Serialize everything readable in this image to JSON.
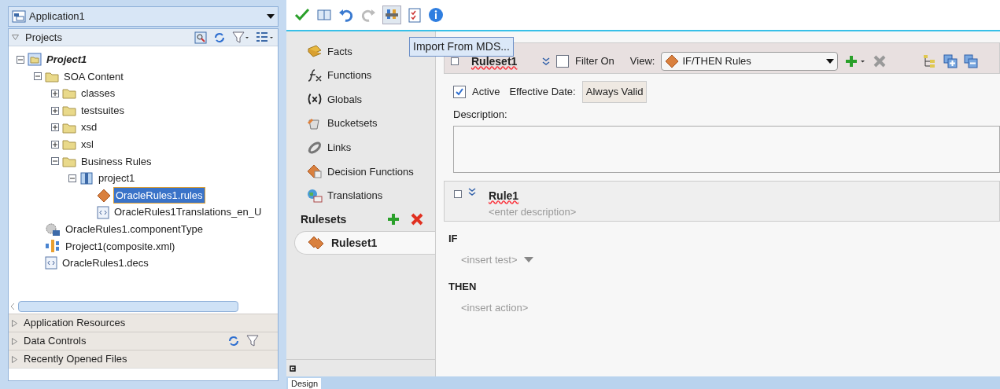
{
  "navigator": {
    "app_selector": "Application1",
    "projects_title": "Projects",
    "tree": [
      {
        "label": "Project1",
        "kind": "project",
        "expanded": true,
        "selected": false,
        "children": [
          {
            "label": "SOA Content",
            "kind": "folder",
            "expanded": true,
            "selected": false,
            "children": [
              {
                "label": "classes",
                "kind": "folder",
                "expanded": false,
                "selected": false
              },
              {
                "label": "testsuites",
                "kind": "folder",
                "expanded": false,
                "selected": false
              },
              {
                "label": "xsd",
                "kind": "folder",
                "expanded": false,
                "selected": false
              },
              {
                "label": "xsl",
                "kind": "folder",
                "expanded": false,
                "selected": false
              },
              {
                "label": "Business Rules",
                "kind": "folder",
                "expanded": true,
                "selected": false,
                "children": [
                  {
                    "label": "project1",
                    "kind": "package",
                    "expanded": true,
                    "selected": false,
                    "children": [
                      {
                        "label": "OracleRules1.rules",
                        "kind": "rules",
                        "selected": true
                      },
                      {
                        "label": "OracleRules1Translations_en_U",
                        "kind": "xml",
                        "selected": false
                      }
                    ]
                  }
                ]
              }
            ]
          },
          {
            "label": "OracleRules1.componentType",
            "kind": "gear",
            "selected": false
          },
          {
            "label": "Project1(composite.xml)",
            "kind": "composite",
            "selected": false
          },
          {
            "label": "OracleRules1.decs",
            "kind": "xml",
            "selected": false
          }
        ]
      }
    ],
    "sections": [
      "Application Resources",
      "Data Controls",
      "Recently Opened Files"
    ]
  },
  "tooltip": "Import From MDS...",
  "rules_nav": {
    "items": [
      "Facts",
      "Functions",
      "Globals",
      "Bucketsets",
      "Links",
      "Decision Functions",
      "Translations"
    ],
    "rulesets_title": "Rulesets",
    "rulesets": [
      {
        "label": "Ruleset1",
        "selected": true
      }
    ]
  },
  "ruleset": {
    "title": "Ruleset1",
    "filter_label": "Filter On",
    "filter_on": false,
    "view_label": "View:",
    "view_value": "IF/THEN Rules",
    "active_label": "Active",
    "active": true,
    "effective_date_label": "Effective Date:",
    "effective_date": "Always Valid",
    "description_label": "Description:",
    "rule": {
      "title": "Rule1",
      "description_placeholder": "<enter description>",
      "if_label": "IF",
      "test_placeholder": "<insert test>",
      "then_label": "THEN",
      "action_placeholder": "<insert action>"
    }
  },
  "bottom_tab": "Design"
}
